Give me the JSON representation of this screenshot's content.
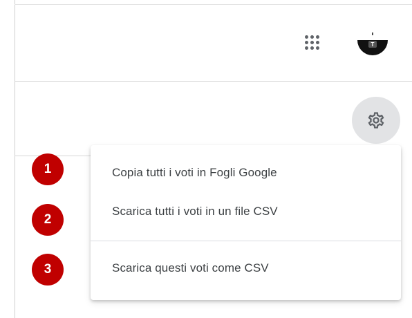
{
  "header": {
    "apps_icon": "apps-grid-icon",
    "avatar_icon": "account-avatar-icon"
  },
  "toolbar": {
    "settings_icon": "gear-icon"
  },
  "menu": {
    "items": [
      {
        "label": "Copia tutti i voti in Fogli Google"
      },
      {
        "label": "Scarica tutti i voti in un file CSV"
      },
      {
        "label": "Scarica questi voti come CSV"
      }
    ]
  },
  "callouts": [
    "1",
    "2",
    "3"
  ],
  "colors": {
    "callout": "#c00000",
    "gear_background": "#e2e3e5",
    "menu_text": "#3c4043"
  }
}
